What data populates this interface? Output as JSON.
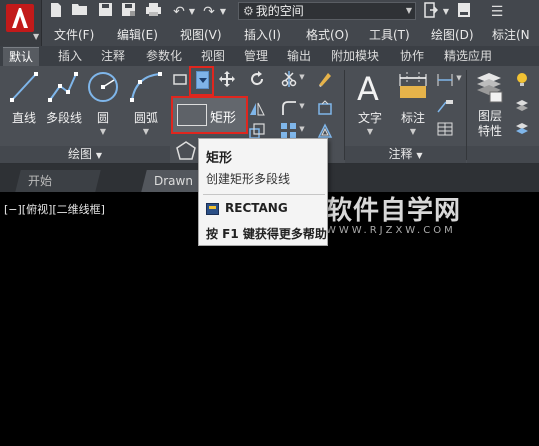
{
  "workspace": {
    "value": "我的空间"
  },
  "menu": [
    "文件(F)",
    "编辑(E)",
    "视图(V)",
    "插入(I)",
    "格式(O)",
    "工具(T)",
    "绘图(D)",
    "标注(N"
  ],
  "ribbon_tabs": [
    "默认",
    "插入",
    "注释",
    "参数化",
    "视图",
    "管理",
    "输出",
    "附加模块",
    "协作",
    "精选应用"
  ],
  "tools": {
    "line": "直线",
    "polyline": "多段线",
    "circle": "圆",
    "arc": "圆弧",
    "rectangle": "矩形",
    "text": "文字",
    "dimension": "标注",
    "layer_props": "图层\n特性"
  },
  "panels": {
    "draw": "绘图",
    "annotate": "注释"
  },
  "doc_tabs": [
    "开始",
    "Drawn"
  ],
  "viewport_label": "[−][俯视][二维线框]",
  "tooltip": {
    "title": "矩形",
    "description": "创建矩形多段线",
    "command": "RECTANG",
    "help": "按 F1 键获得更多帮助"
  },
  "watermark": {
    "title": "软件自学网",
    "url": "WWW.RJZXW.COM"
  },
  "colors": {
    "accent_red": "#e0261e",
    "background": "#000000",
    "ribbon": "#4b4f55"
  }
}
